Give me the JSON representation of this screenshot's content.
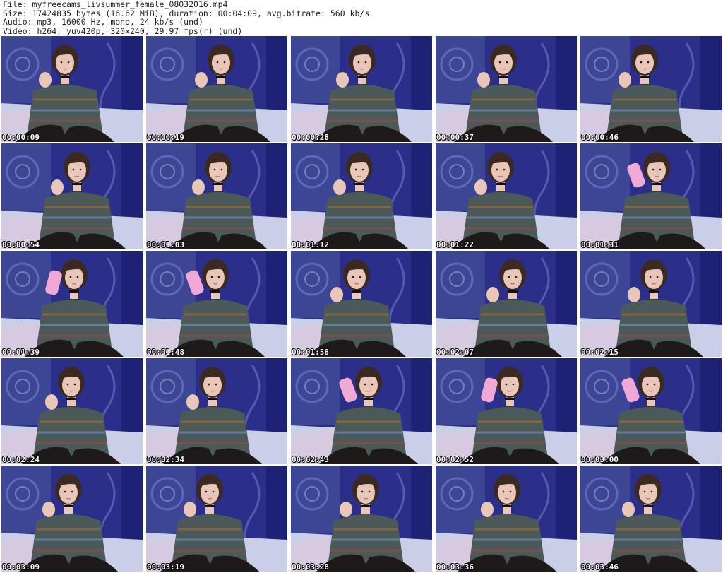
{
  "header": {
    "file": "File: myfreecams_livsummer_female_08032016.mp4",
    "size": "Size: 17424835 bytes (16.62 MiB), duration: 00:04:09, avg.bitrate: 560 kb/s",
    "audio": "Audio: mp3, 16000 Hz, mono, 24 kb/s (und)",
    "video": "Video: h264, yuv420p, 320x240, 29.97 fps(r) (und)"
  },
  "frames": [
    {
      "time": "00:00:09",
      "bottle": false
    },
    {
      "time": "00:00:19",
      "bottle": false
    },
    {
      "time": "00:00:28",
      "bottle": false
    },
    {
      "time": "00:00:37",
      "bottle": false
    },
    {
      "time": "00:00:46",
      "bottle": false
    },
    {
      "time": "00:00:54",
      "bottle": false
    },
    {
      "time": "00:01:03",
      "bottle": false
    },
    {
      "time": "00:01:12",
      "bottle": false
    },
    {
      "time": "00:01:22",
      "bottle": false
    },
    {
      "time": "00:01:31",
      "bottle": true
    },
    {
      "time": "00:01:39",
      "bottle": true
    },
    {
      "time": "00:01:48",
      "bottle": true
    },
    {
      "time": "00:01:58",
      "bottle": false
    },
    {
      "time": "00:02:07",
      "bottle": false
    },
    {
      "time": "00:02:15",
      "bottle": false
    },
    {
      "time": "00:02:24",
      "bottle": false
    },
    {
      "time": "00:02:34",
      "bottle": false
    },
    {
      "time": "00:02:43",
      "bottle": true
    },
    {
      "time": "00:02:52",
      "bottle": true
    },
    {
      "time": "00:03:00",
      "bottle": true
    },
    {
      "time": "00:03:09",
      "bottle": false
    },
    {
      "time": "00:03:19",
      "bottle": false
    },
    {
      "time": "00:03:28",
      "bottle": false
    },
    {
      "time": "00:03:36",
      "bottle": false
    },
    {
      "time": "00:03:46",
      "bottle": false
    }
  ],
  "colors": {
    "wall": "#2c2f8a",
    "wall_light": "#6a78c8",
    "bed": "#c9cfe6",
    "sweater": "#4b5a58",
    "skin": "#e9c7b8",
    "hair": "#3b2a22",
    "legs": "#1f1a1a",
    "bottle": "#f0a8d6"
  }
}
